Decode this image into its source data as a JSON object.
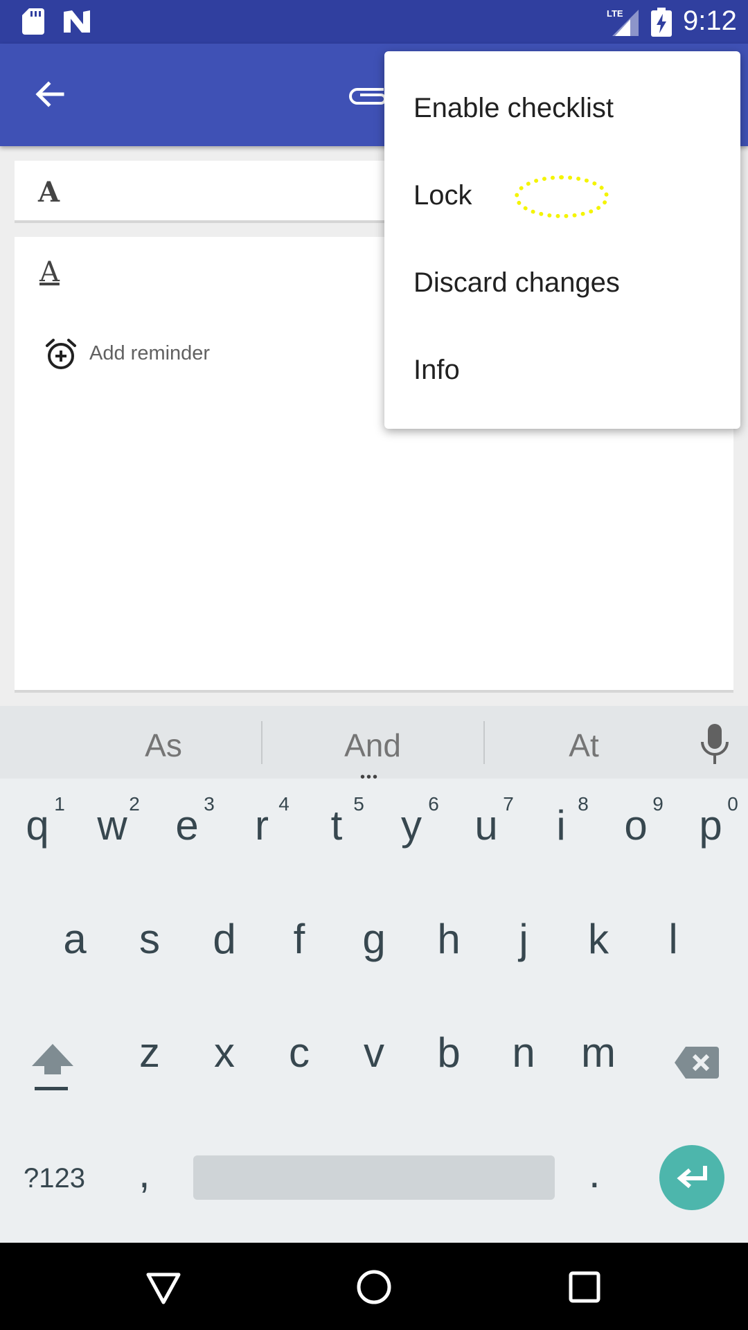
{
  "status_bar": {
    "time": "9:12",
    "network": "LTE",
    "icons": [
      "sd-card-icon",
      "n-logo-icon",
      "lte-signal-icon",
      "battery-charging-icon"
    ]
  },
  "app_bar": {
    "icons": [
      "back-arrow-icon",
      "attachment-icon"
    ]
  },
  "note": {
    "title": "A",
    "content": "A",
    "reminder_label": "Add reminder"
  },
  "menu": {
    "items": [
      {
        "label": "Enable checklist"
      },
      {
        "label": "Lock"
      },
      {
        "label": "Discard changes"
      },
      {
        "label": "Info"
      }
    ]
  },
  "keyboard": {
    "suggestions": [
      "As",
      "And",
      "At"
    ],
    "row1": [
      "q",
      "w",
      "e",
      "r",
      "t",
      "y",
      "u",
      "i",
      "o",
      "p"
    ],
    "row1_hints": [
      "1",
      "2",
      "3",
      "4",
      "5",
      "6",
      "7",
      "8",
      "9",
      "0"
    ],
    "row2": [
      "a",
      "s",
      "d",
      "f",
      "g",
      "h",
      "j",
      "k",
      "l"
    ],
    "row3": [
      "z",
      "x",
      "c",
      "v",
      "b",
      "n",
      "m"
    ],
    "symbols_label": "?123",
    "comma": ",",
    "period": ".",
    "accent_color": "#4db6ac"
  },
  "colors": {
    "status_bar": "#303f9f",
    "app_bar": "#3f51b5",
    "highlight": "#f4f400"
  }
}
